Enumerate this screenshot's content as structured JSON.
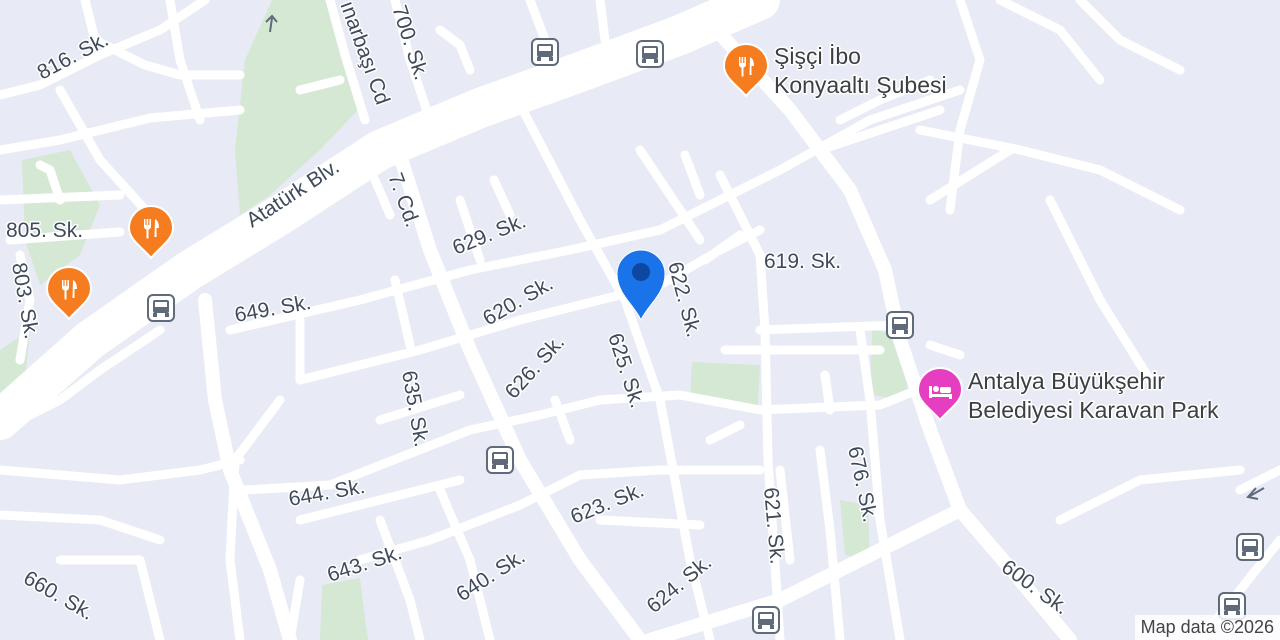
{
  "colors": {
    "land": "#e8eaf6",
    "road": "#ffffff",
    "park": "#d5e8d4",
    "restaurant_pin": "#f57c1f",
    "hotel_pin": "#e53ec1",
    "bus_stop": "#5f6b7a",
    "location_pin": "#1a73e8"
  },
  "streets": {
    "s816": "816. Sk.",
    "s700": "700. Sk.",
    "pinarbasi": "ınarbaşı Cd",
    "ataturk": "Atatürk Blv.",
    "s7cd": "7. Cd.",
    "s805": "805. Sk.",
    "s803": "803. Sk.",
    "s629": "629. Sk.",
    "s649": "649. Sk.",
    "s620": "620. Sk.",
    "s622": "622. Sk.",
    "s619": "619. Sk.",
    "s626": "626. Sk.",
    "s625": "625. Sk.",
    "s635": "635. Sk.",
    "s644": "644. Sk.",
    "s623": "623. Sk.",
    "s621": "621. Sk.",
    "s676": "676. Sk.",
    "s643": "643. Sk.",
    "s640": "640. Sk.",
    "s624": "624. Sk.",
    "s660": "660. Sk.",
    "s600": "600. Sk."
  },
  "pois": {
    "sisci_line1": "Şişçi İbo",
    "sisci_line2": "Konyaaltı Şubesi",
    "karavan_line1": "Antalya Büyükşehir",
    "karavan_line2": "Belediyesi Karavan Park"
  },
  "icons": {
    "restaurant": "fork-knife-icon",
    "hotel": "bed-icon",
    "bus": "bus-icon",
    "location": "location-pin-icon"
  },
  "attribution": "Map data ©2026"
}
